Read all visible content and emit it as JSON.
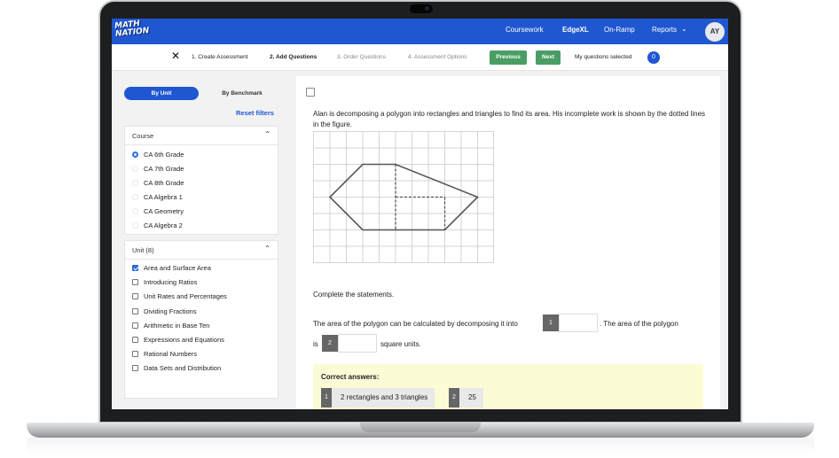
{
  "nav": {
    "logo": "MATH NATION",
    "items": [
      "Coursework",
      "EdgeXL",
      "On-Ramp",
      "Reports"
    ],
    "active_item": "EdgeXL",
    "reports_chevron": "chevron-down-icon",
    "avatar": "AY",
    "color": "#1f57d1"
  },
  "steps": {
    "close": "✕",
    "items": [
      "1. Create Assessment",
      "2. Add Questions",
      "3. Order Questions",
      "4. Assessment Options"
    ],
    "active": "2. Add Questions",
    "previous": "Previous",
    "next": "Next",
    "selected_label": "My questions selected",
    "selected_count": "0"
  },
  "sidebar": {
    "by_unit": "By Unit",
    "by_benchmark": "By Benchmark",
    "reset": "Reset filters",
    "course": {
      "title": "Course",
      "options": [
        "CA 6th Grade",
        "CA 7th Grade",
        "CA 8th Grade",
        "CA Algebra 1",
        "CA Geometry",
        "CA Algebra 2"
      ],
      "selected": "CA 6th Grade"
    },
    "unit": {
      "title": "Unit (8)",
      "options": [
        "Area and Surface Area",
        "Introducing Ratios",
        "Unit Rates and Percentages",
        "Dividing Fractions",
        "Arithmetic in Base Ten",
        "Expressions and Equations",
        "Rational Numbers",
        "Data Sets and Distribution"
      ],
      "checked": [
        "Area and Surface Area"
      ]
    }
  },
  "question": {
    "prompt": "Alan is decomposing a polygon into rectangles and triangles to find its area. His incomplete work is shown by the dotted lines in the figure.",
    "complete": "Complete the statements.",
    "line1_before": "The area of the polygon can be calculated by decomposing it into",
    "line1_after": ". The area of the polygon",
    "line2_before": "is",
    "line2_after": "square units.",
    "blank1": "1",
    "blank2": "2",
    "answers_title": "Correct answers:",
    "answers": [
      {
        "num": "1",
        "text": "2 rectangles and 3 triangles"
      },
      {
        "num": "2",
        "text": "25"
      }
    ]
  }
}
